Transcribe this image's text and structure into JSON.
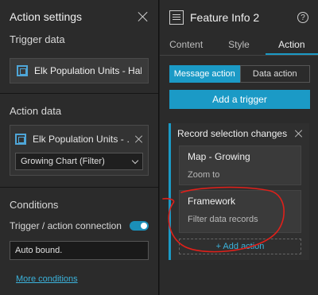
{
  "action_settings": {
    "title": "Action settings",
    "trigger_data_label": "Trigger data",
    "trigger_data_source": "Elk Population Units - Hab…",
    "action_data_label": "Action data",
    "action_data_source": "Elk Population Units - …",
    "action_data_select": "Growing Chart (Filter)",
    "conditions_label": "Conditions",
    "trigger_action_connection_label": "Trigger / action connection",
    "connection_toggle_on": true,
    "auto_bound_value": "Auto bound.",
    "more_conditions_link": "More conditions"
  },
  "feature_info": {
    "title": "Feature Info 2",
    "help_glyph": "?",
    "tabs": [
      "Content",
      "Style",
      "Action"
    ],
    "active_tab": "Action",
    "message_action_label": "Message action",
    "data_action_label": "Data action",
    "add_trigger_label": "Add a trigger",
    "trigger": {
      "title": "Record selection changes",
      "actions": [
        {
          "name": "Map - Growing",
          "description": "Zoom to"
        },
        {
          "name": "Framework",
          "description": "Filter data records"
        }
      ],
      "add_action_label": "+ Add action"
    }
  },
  "colors": {
    "accent": "#1b9ac6",
    "link": "#3bb3dc",
    "annotation_red": "#e0201a"
  }
}
